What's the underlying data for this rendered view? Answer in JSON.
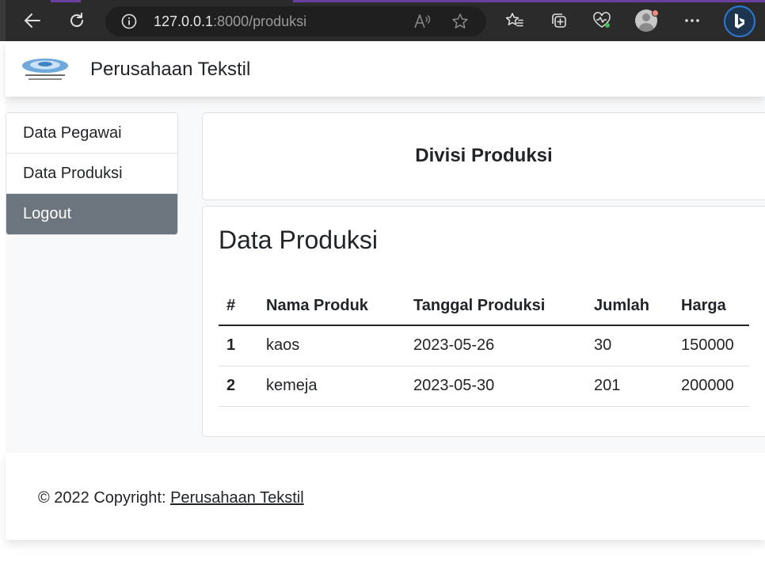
{
  "browser": {
    "url_host": "127.0.0.1",
    "url_rest": ":8000/produksi"
  },
  "navbar": {
    "brand": "Perusahaan Tekstil"
  },
  "sidebar": {
    "items": [
      {
        "label": "Data Pegawai"
      },
      {
        "label": "Data Produksi"
      },
      {
        "label": "Logout"
      }
    ]
  },
  "division": {
    "title": "Divisi Produksi"
  },
  "table_card": {
    "title": "Data Produksi",
    "columns": [
      "#",
      "Nama Produk",
      "Tanggal Produksi",
      "Jumlah",
      "Harga"
    ],
    "rows": [
      [
        "1",
        "kaos",
        "2023-05-26",
        "30",
        "150000"
      ],
      [
        "2",
        "kemeja",
        "2023-05-30",
        "201",
        "200000"
      ]
    ]
  },
  "footer": {
    "prefix": "© 2022 Copyright: ",
    "link": "Perusahaan Tekstil"
  },
  "colors": {
    "sidebar_active": "#6c757d",
    "chrome_bg": "#2b2b2b",
    "page_bg": "#f8f9fa"
  }
}
